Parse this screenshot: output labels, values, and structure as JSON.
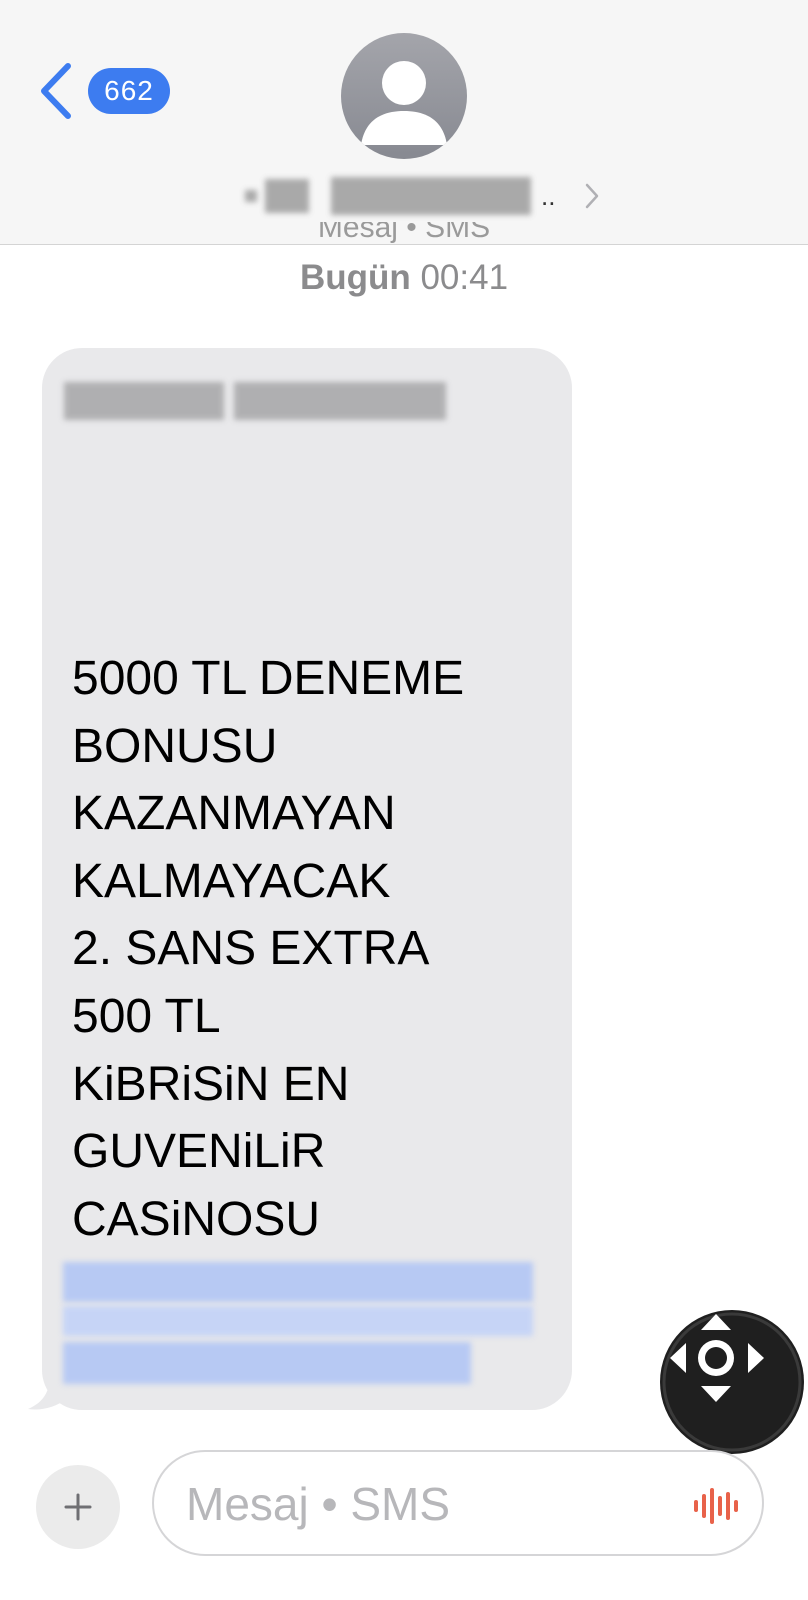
{
  "header": {
    "unread_count": "662",
    "contact_name_suffix": "..",
    "avatar_icon": "person-icon"
  },
  "conversation": {
    "service_label": "Mesaj • SMS",
    "timestamp_day": "Bugün",
    "timestamp_time": "00:41",
    "message": {
      "text": "5000 TL DENEME\nBONUSU\nKAZANMAYAN\nKALMAYACAK\n2. SANS EXTRA\n500 TL\nKiBRiSiN EN\nGUVENiLiR\nCASiNOSU"
    }
  },
  "input_bar": {
    "placeholder": "Mesaj • SMS",
    "value": ""
  },
  "colors": {
    "accent": "#3d7cf0",
    "bubble_gray": "#e9e9eb",
    "mic_red": "#e8624a"
  }
}
